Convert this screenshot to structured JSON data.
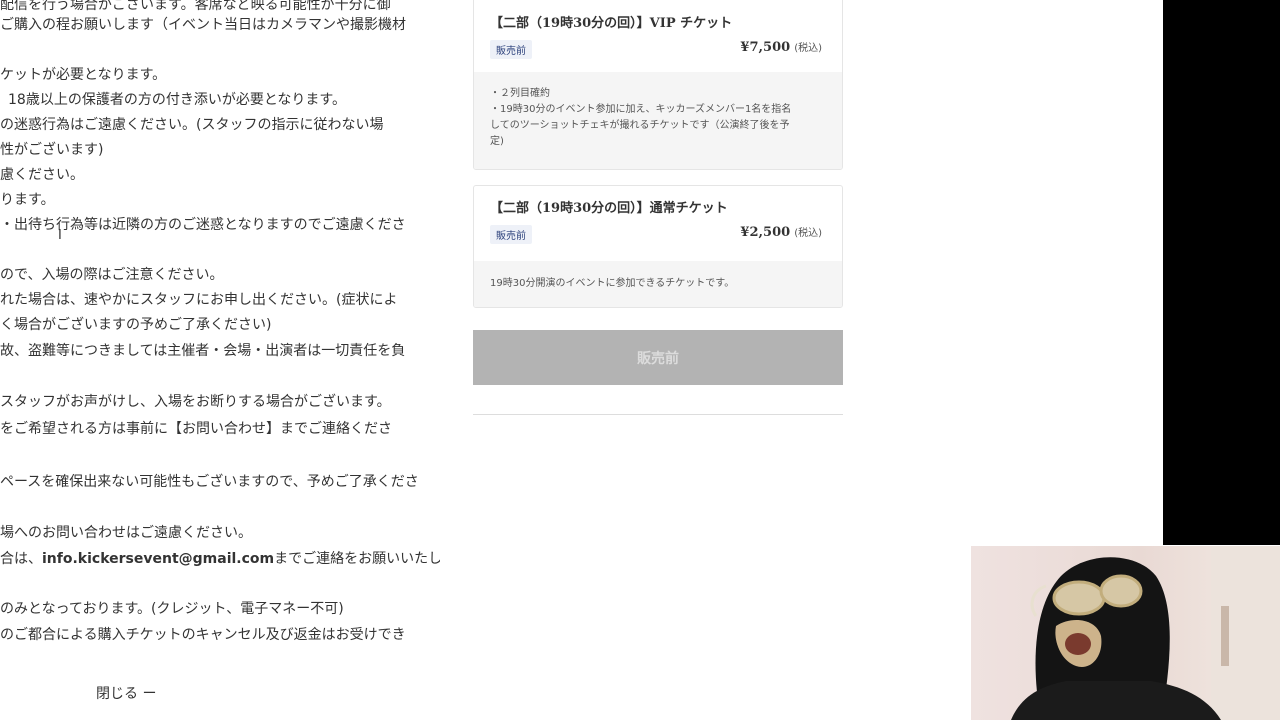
{
  "left_text": {
    "lines": [
      "配信を行う場合がございます。客席など映る可能性が十分に御",
      "ご購入の程お願いします（イベント当日はカメラマンや撮影機材",
      "ケットが必要となります。",
      "18歳以上の保護者の方の付き添いが必要となります。",
      "の迷惑行為はご遠慮ください。(スタッフの指示に従わない場",
      "性がございます)",
      "慮ください。",
      "ります。",
      "・出待ち行為等は近隣の方のご迷惑となりますのでご遠慮くださ",
      "ので、入場の際はご注意ください。",
      "れた場合は、速やかにスタッフにお申し出ください。(症状によ",
      "く場合がございますの予めご了承ください)",
      "故、盗難等につきましては主催者・会場・出演者は一切責任を負",
      "スタッフがお声がけし、入場をお断りする場合がございます。",
      "をご希望される方は事前に【お問い合わせ】までご連絡くださ",
      "ペースを確保出来ない可能性もございますので、予めご了承くださ",
      "場へのお問い合わせはご遠慮ください。",
      "合は、",
      "までご連絡をお願いいたし",
      "のみとなっております。(クレジット、電子マネー不可)",
      "のご都合による購入チケットのキャンセル及び返金はお受けでき"
    ],
    "email": "info.kickersevent@gmail.com",
    "close_label": "閉じる ー"
  },
  "tickets": [
    {
      "title": "【二部（19時30分の回）】VIP チケット",
      "badge": "販売前",
      "price": "¥7,500",
      "tax": "(税込)",
      "desc": [
        "・２列目確約",
        "・19時30分のイベント参加に加え、キッカーズメンバー1名を指名",
        "してのツーショットチェキが撮れるチケットです（公演終了後を予",
        "定)"
      ]
    },
    {
      "title": "【二部（19時30分の回）】通常チケット",
      "badge": "販売前",
      "price": "¥2,500",
      "tax": "(税込)",
      "desc": [
        "19時30分開演のイベントに参加できるチケットです。"
      ]
    }
  ],
  "sale_button_label": "販売前",
  "colors": {
    "badge_bg": "#eef1f8",
    "badge_text": "#2a3f7a",
    "disabled_button": "#b3b3b3",
    "desc_bg": "#f5f5f5"
  },
  "icons": {
    "cursor": "text-cursor-icon"
  }
}
